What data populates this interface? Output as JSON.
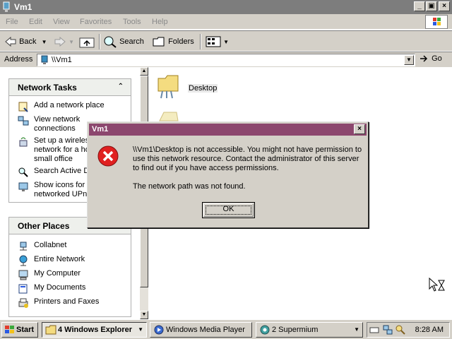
{
  "window": {
    "title": "Vm1",
    "menu": [
      "File",
      "Edit",
      "View",
      "Favorites",
      "Tools",
      "Help"
    ],
    "toolbar": {
      "back": "Back",
      "search": "Search",
      "folders": "Folders"
    },
    "address": {
      "label": "Address",
      "value": "\\\\Vm1",
      "go": "Go"
    }
  },
  "left_pane": {
    "network_tasks": {
      "title": "Network Tasks",
      "items": [
        {
          "label": "Add a network place",
          "icon": "add-network-place-icon"
        },
        {
          "label": "View network",
          "label2": "connections",
          "icon": "network-connections-icon"
        },
        {
          "label": "Set up a wireless",
          "label2": "network for a home or",
          "label3": "small office",
          "icon": "wireless-network-icon"
        },
        {
          "label": "Search Active Directory",
          "icon": "search-directory-icon"
        },
        {
          "label": "Show icons for",
          "label2": "networked UPnP devices",
          "icon": "upnp-devices-icon"
        }
      ]
    },
    "other_places": {
      "title": "Other Places",
      "items": [
        {
          "label": "Collabnet",
          "icon": "network-share-icon"
        },
        {
          "label": "Entire Network",
          "icon": "entire-network-icon"
        },
        {
          "label": "My Computer",
          "icon": "my-computer-icon"
        },
        {
          "label": "My Documents",
          "icon": "my-documents-icon"
        },
        {
          "label": "Printers and Faxes",
          "icon": "printers-faxes-icon"
        }
      ]
    }
  },
  "content": {
    "items": [
      {
        "label": "Desktop",
        "icon": "shared-folder-icon"
      }
    ]
  },
  "dialog": {
    "title": "Vm1",
    "message": "\\\\Vm1\\Desktop is not accessible. You might not have permission to use this network resource. Contact the administrator of this server to find out if you have access permissions.",
    "detail": "The network path was not found.",
    "ok": "OK"
  },
  "taskbar": {
    "start": "Start",
    "tasks": [
      {
        "label": "4 Windows Explorer",
        "active": true
      },
      {
        "label": "Windows Media Player",
        "active": false
      },
      {
        "label": "2 Supermium",
        "active": false
      }
    ],
    "clock": "8:28 AM"
  },
  "colors": {
    "dialog_title": "#8c476e",
    "window_title_inactive": "#7d7d7d",
    "face": "#d4d0c8"
  }
}
